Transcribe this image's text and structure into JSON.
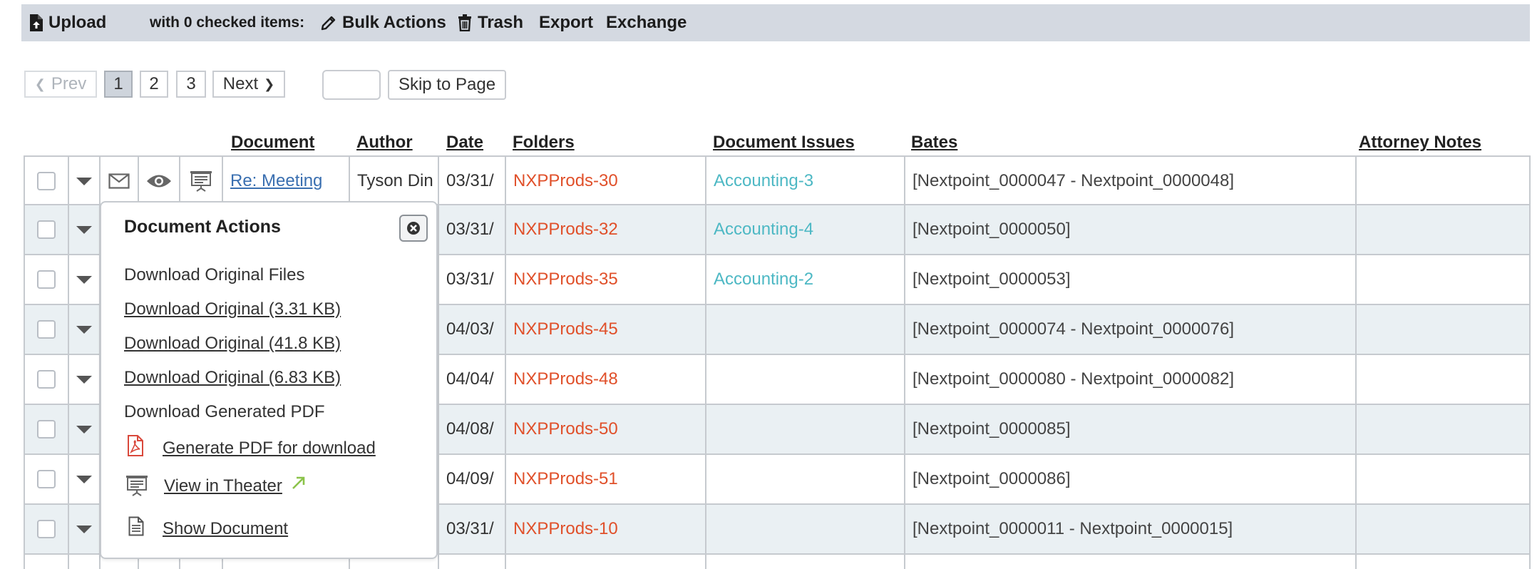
{
  "toolbar": {
    "upload": "Upload",
    "checked_items": "with 0 checked items:",
    "bulk_actions": "Bulk Actions",
    "trash": "Trash",
    "export": "Export",
    "exchange": "Exchange"
  },
  "pagination": {
    "prev": "Prev",
    "pages": [
      "1",
      "2",
      "3"
    ],
    "current": "1",
    "next": "Next",
    "page_input_value": "",
    "skip": "Skip to Page"
  },
  "columns": {
    "document": "Document",
    "author": "Author",
    "date": "Date",
    "folders": "Folders",
    "issues": "Document Issues",
    "bates": "Bates",
    "notes": "Attorney Notes"
  },
  "rows": [
    {
      "document": "Re: Meeting",
      "author": "Tyson Din",
      "date": "03/31/",
      "folder": "NXPProds-30",
      "issue": "Accounting-3",
      "bates": "[Nextpoint_0000047 - Nextpoint_0000048]",
      "notes": ""
    },
    {
      "document": "",
      "author": "",
      "date": "03/31/",
      "folder": "NXPProds-32",
      "issue": "Accounting-4",
      "bates": "[Nextpoint_0000050]",
      "notes": ""
    },
    {
      "document": "",
      "author": "",
      "date": "03/31/",
      "folder": "NXPProds-35",
      "issue": "Accounting-2",
      "bates": "[Nextpoint_0000053]",
      "notes": ""
    },
    {
      "document": "",
      "author": "",
      "date": "04/03/",
      "folder": "NXPProds-45",
      "issue": "",
      "bates": "[Nextpoint_0000074 - Nextpoint_0000076]",
      "notes": ""
    },
    {
      "document": "",
      "author": "",
      "date": "04/04/",
      "folder": "NXPProds-48",
      "issue": "",
      "bates": "[Nextpoint_0000080 - Nextpoint_0000082]",
      "notes": ""
    },
    {
      "document": "",
      "author": "",
      "date": "04/08/",
      "folder": "NXPProds-50",
      "issue": "",
      "bates": "[Nextpoint_0000085]",
      "notes": ""
    },
    {
      "document": "",
      "author": "",
      "date": "04/09/",
      "folder": "NXPProds-51",
      "issue": "",
      "bates": "[Nextpoint_0000086]",
      "notes": ""
    },
    {
      "document": "",
      "author": "",
      "date": "03/31/",
      "folder": "NXPProds-10",
      "issue": "",
      "bates": "[Nextpoint_0000011 - Nextpoint_0000015]",
      "notes": ""
    }
  ],
  "popup": {
    "title": "Document Actions",
    "download_original_heading": "Download Original Files",
    "downloads": [
      "Download Original (3.31 KB)",
      "Download Original (41.8 KB)",
      "Download Original (6.83 KB)"
    ],
    "generated_pdf_heading": "Download Generated PDF",
    "generate_pdf": "Generate PDF for download",
    "view_theater": "View in Theater",
    "show_document": "Show Document"
  },
  "colors": {
    "toolbar_bg": "#d4d9e1",
    "folder_link": "#e0502a",
    "issue_link": "#4db8c4",
    "doc_link": "#3a6fb0",
    "row_alt": "#eaf0f3",
    "external_arrow": "#8bc34a",
    "pdf_icon": "#d9483b"
  }
}
